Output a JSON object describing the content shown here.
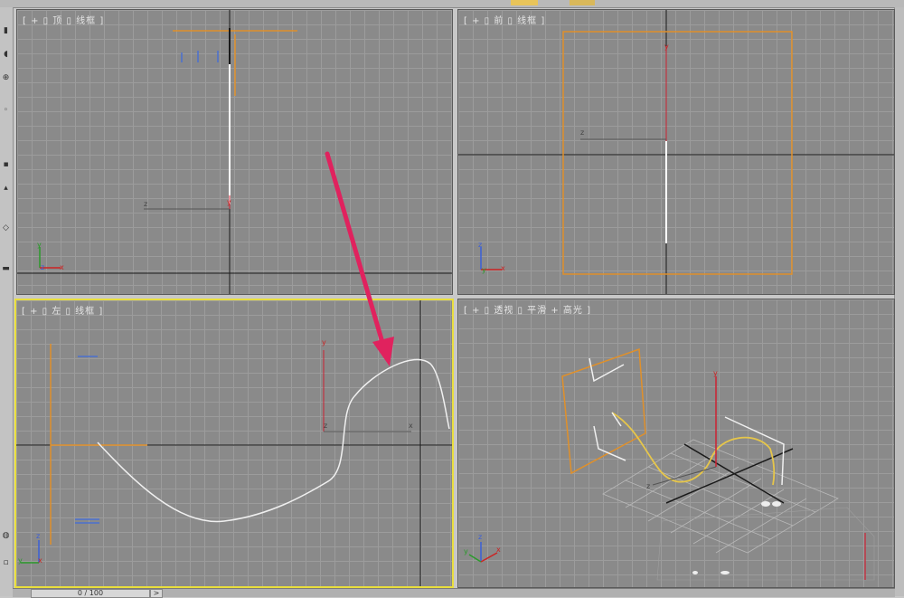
{
  "viewports": {
    "top": {
      "label": "[ + ▯ 顶 ▯ 线框 ]"
    },
    "front": {
      "label": "[ + ▯ 前 ▯ 线框 ]"
    },
    "left": {
      "label": "[ + ▯ 左 ▯ 线框 ]"
    },
    "perspective": {
      "label": "[ + ▯ 透视 ▯ 平滑 + 高光 ]"
    }
  },
  "axes": {
    "x": "x",
    "y": "y",
    "z": "z"
  },
  "timeline": {
    "slider": "0 / 100",
    "next": ">"
  },
  "colors": {
    "accent_orange": "#e0902a",
    "active_border": "#e9de3c",
    "arrow": "#e0225e",
    "spline": "#f0f0f0",
    "spline_selected": "#e6c64a"
  }
}
